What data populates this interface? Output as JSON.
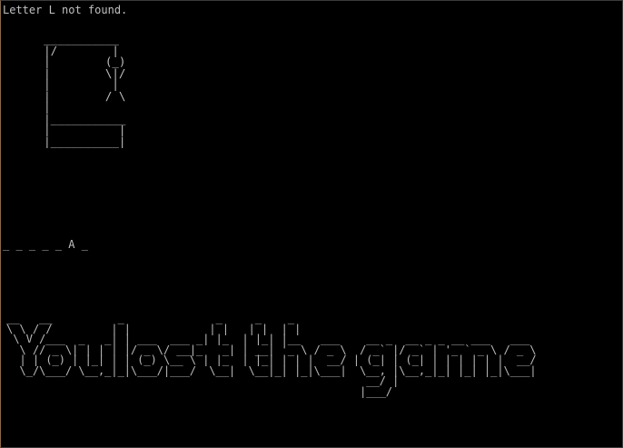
{
  "terminal": {
    "status_message": "Letter L not found.",
    "gallows_art": "      ___________\n      |/        |\n      |        (_)\n      |        \\|/\n      |         |\n      |        / \\\n      |\n      |___________\n      |          |\n      |__________|",
    "word_progress": "_ _ _ _ _ A _",
    "banner_text": "You lost the game",
    "banner_art": "__   __          _              _     _    _\n\\ \\ / /         | |            | |   | |  | |\n \\ V /___  _   _| | ___  ___ _| |_  | |_| |__   ___    __ _  __ _ _ __ ___   ___\n  \\ // _ \\| | | | |/ _ \\/ __|_   _| | __| '_ \\ / _ \\  / _` |/ _` | '_ ` _ \\ / _ \\\n  | | (_) | |_| | | (_) \\__ \\ | |_  | |_| | | |  __/ | (_| | (_| | | | | | |  __/\n  \\_/\\___/ \\__,_|_|\\___/|___/  \\__|  \\__|_| |_|\\___|  \\__, |\\__,_|_| |_| |_|\\___|\n                                                       __/ |\n                                                      |___/"
  }
}
